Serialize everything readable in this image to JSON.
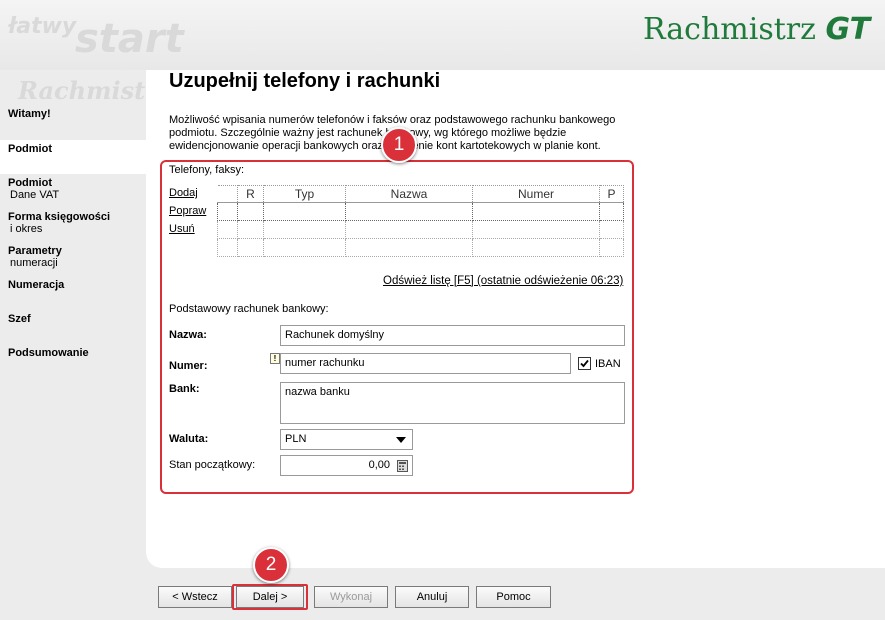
{
  "logo": {
    "brand": "Rachmistrz",
    "suffix": "GT"
  },
  "watermark": {
    "line1": "łatwy",
    "line2": "start",
    "line3": "Rachmistrz"
  },
  "sidebar": {
    "items": [
      {
        "title": "Witamy!",
        "sub": ""
      },
      {
        "title": "Podmiot",
        "sub": ""
      },
      {
        "title": "Podmiot",
        "sub": "Dane VAT"
      },
      {
        "title": "Forma księgowości",
        "sub": "i okres"
      },
      {
        "title": "Parametry",
        "sub": "numeracji"
      },
      {
        "title": "Numeracja",
        "sub": ""
      },
      {
        "title": "Szef",
        "sub": ""
      },
      {
        "title": "Podsumowanie",
        "sub": ""
      }
    ]
  },
  "page": {
    "title": "Uzupełnij telefony i rachunki",
    "description": "Możliwość wpisania numerów telefonów i faksów oraz podstawowego rachunku bankowego podmiotu. Szczególnie ważny jest rachunek bankowy, wg którego możliwe będzie ewidencjonowanie operacji bankowych oraz tworzenie kont kartotekowych w planie kont."
  },
  "phones": {
    "label": "Telefony, faksy:",
    "actions": {
      "add": "Dodaj",
      "edit": "Popraw",
      "delete": "Usuń"
    },
    "columns": [
      "R",
      "Typ",
      "Nazwa",
      "Numer",
      "P"
    ],
    "refresh": "Odśwież listę [F5] (ostatnie odświeżenie 06:23)"
  },
  "bank": {
    "section_label": "Podstawowy rachunek bankowy:",
    "name_label": "Nazwa:",
    "name_value": "Rachunek domyślny",
    "number_label": "Numer:",
    "number_value": "numer rachunku",
    "iban_label": "IBAN",
    "bank_label": "Bank:",
    "bank_value": "nazwa banku",
    "currency_label": "Waluta:",
    "currency_value": "PLN",
    "opening_label": "Stan początkowy:",
    "opening_value": "0,00",
    "warning_mark": "!"
  },
  "badges": {
    "one": "1",
    "two": "2"
  },
  "buttons": {
    "back": "< Wstecz",
    "next": "Dalej >",
    "execute": "Wykonaj",
    "cancel": "Anuluj",
    "help": "Pomoc"
  },
  "colors": {
    "accent_red": "#d9303a",
    "logo_green": "#1f7a3c"
  }
}
